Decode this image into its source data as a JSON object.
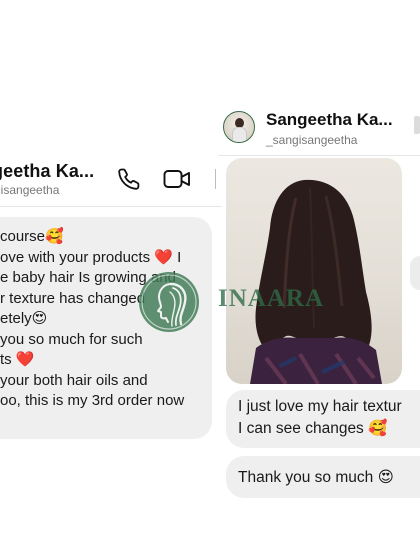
{
  "left_chat": {
    "contact_name": "geetha Ka...",
    "contact_handle": "gisangeetha",
    "message_lines": [
      "course🥰",
      "ove with your products ❤️ I",
      "e baby hair Is growing and",
      "r texture has changed",
      "etely😍",
      "you so much for such",
      "ts ❤️",
      "your both hair oils and",
      "oo, this is my 3rd order now"
    ]
  },
  "right_chat": {
    "contact_name": "Sangeetha Ka...",
    "contact_handle": "_sangisangeetha",
    "message1_lines": [
      "I just love my hair textur",
      "I can see changes 🥰"
    ],
    "message2_lines": [
      "Thank you so much 😍"
    ]
  },
  "watermark": {
    "brand_text": "INAARA"
  },
  "icons": {
    "call": "phone-icon",
    "video": "video-camera-icon"
  },
  "colors": {
    "bubble": "#efefef",
    "watermark_green": "#2f6b48",
    "heart_red": "#e0202e"
  }
}
